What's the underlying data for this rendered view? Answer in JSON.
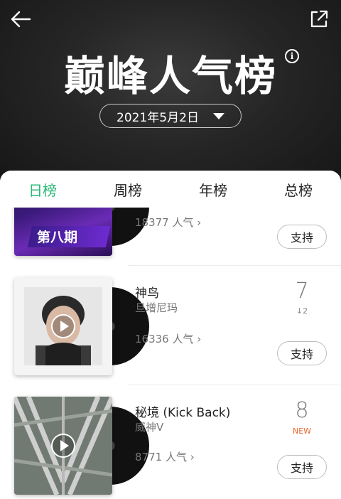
{
  "header": {
    "title": "巅峰人气榜",
    "date": "2021年5月2日"
  },
  "tabs": [
    {
      "label": "日榜",
      "active": true
    },
    {
      "label": "周榜",
      "active": false
    },
    {
      "label": "年榜",
      "active": false
    },
    {
      "label": "总榜",
      "active": false
    }
  ],
  "entries": [
    {
      "cover_text": "第八期",
      "popularity": "18377 人气",
      "support_label": "支持"
    },
    {
      "song": "神鸟",
      "artist": "旦增尼玛",
      "popularity": "16336 人气",
      "rank": "7",
      "rank_change": "↓2",
      "support_label": "支持"
    },
    {
      "song": "秘境 (Kick Back)",
      "artist": "威神V",
      "popularity": "8771 人气",
      "rank": "8",
      "rank_badge": "NEW",
      "support_label": "支持"
    }
  ],
  "colors": {
    "accent": "#27b876",
    "new_badge": "#e8662b"
  }
}
